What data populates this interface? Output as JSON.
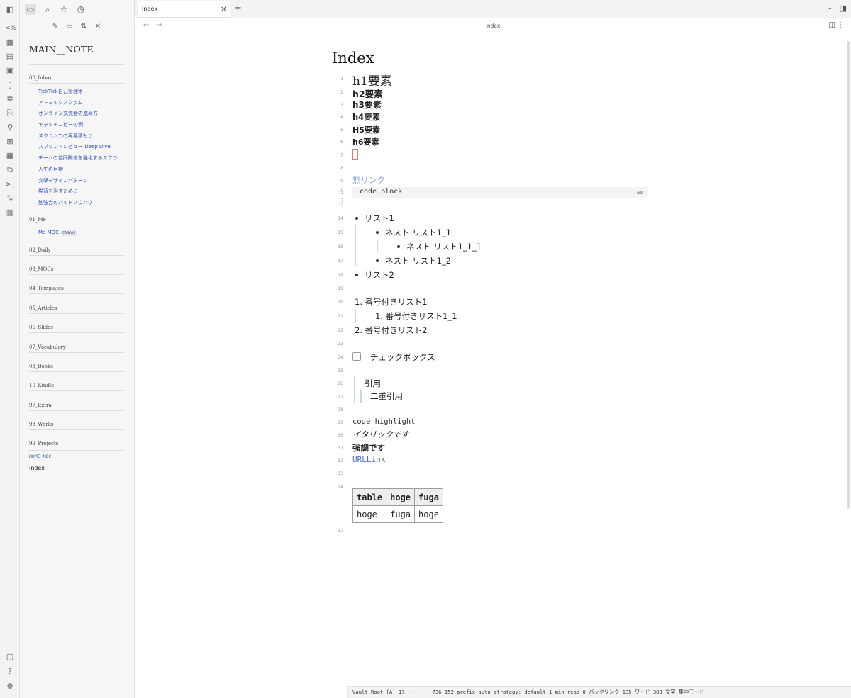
{
  "tab": {
    "title": "Index",
    "close": "×",
    "new": "+"
  },
  "nav": {
    "title": "Index",
    "back": "←",
    "forward": "→"
  },
  "sidebar": {
    "vault_title": "MAIN__NOTE",
    "inbox": {
      "label": "00_Inbox",
      "files": [
        "TickTick自己管理術",
        "アトミックスクラム",
        "オンライン交流会の進め方",
        "キャッチコピーの例",
        "スクラムでの再見積もり",
        "スプリントレビュー Deep Dive",
        "チームの協同関係を強化するスクラ…",
        "人生の目標",
        "突撃デザインパターン",
        "猫背を治すために",
        "勉強会のバッドノウハウ"
      ]
    },
    "me": {
      "label": "01_Me",
      "file": "Me MOC",
      "tag": "CANVAS"
    },
    "folders": [
      "02_Daily",
      "03_MOCs",
      "04_Templates",
      "05_Articles",
      "06_Slides",
      "07_Vocabulary",
      "08_Books",
      "10_Kindle",
      "97_Extra",
      "98_Works",
      "99_Projects"
    ],
    "home_moc": "HOME MOC",
    "index_file": "Index"
  },
  "editor": {
    "title": "Index",
    "line_numbers": [
      "1",
      "2",
      "3",
      "4",
      "5",
      "6",
      "7",
      "8",
      "9",
      "10",
      "11",
      "12",
      "13",
      "14",
      "15",
      "16",
      "17",
      "18",
      "19",
      "20",
      "21",
      "22",
      "23",
      "24",
      "25",
      "26",
      "27",
      "28",
      "29",
      "30",
      "31",
      "32",
      "33",
      "34",
      "37"
    ],
    "headings": [
      "h1要素",
      "h2要素",
      "h3要素",
      "h4要素",
      "H5要素",
      "h6要素"
    ],
    "nolink": "無リンク",
    "code_block": "code block",
    "code_lang": "md",
    "list": [
      "リスト1",
      "ネスト リスト1_1",
      "ネスト リスト1_1_1",
      "ネスト リスト1_2",
      "リスト2"
    ],
    "olist": [
      "1. 番号付きリスト1",
      "1. 番号付きリスト1_1",
      "2. 番号付きリスト2"
    ],
    "checkbox": "チェックボックス",
    "quote": "引用",
    "quote2": "二重引用",
    "code_highlight": "code highlight",
    "italic": "イタリックです",
    "bold": "強調です",
    "url": "URLLink",
    "table": {
      "header": [
        "table",
        "hoge",
        "fuga"
      ],
      "row": [
        "hoge",
        "fuga",
        "hoge"
      ]
    }
  },
  "status": {
    "text": "Vault Root [A]   17  ---  ---  736  152  prefix  auto strategy: default 1 min read 0 バックリンク  135 ワード 388 文字  集中モード"
  }
}
